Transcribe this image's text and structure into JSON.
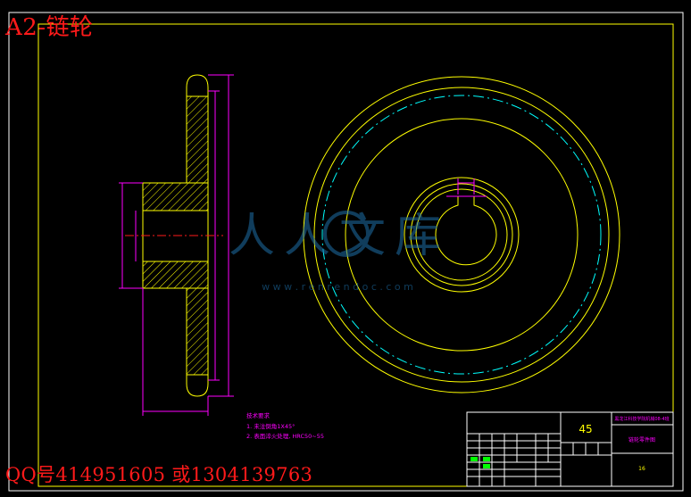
{
  "header": {
    "title": "A2-链轮"
  },
  "footer": {
    "contact": "QQ号414951605 或1304139763"
  },
  "notes": {
    "heading": "技术要求",
    "line1": "1. 未注倒角1X45°",
    "line2": "2. 表面淬火处理, HRC50~55"
  },
  "title_block": {
    "material": "45",
    "school": "黑龙江科技学院机械08-4班",
    "drawing_name": "链轮零件图",
    "sheet_code": "16"
  },
  "watermark": {
    "text": "人人文库",
    "url": "w w w . r e n r e n d o c . c o m"
  },
  "colors": {
    "background": "#000000",
    "outline": "#ffffff",
    "part": "#ffff00",
    "dimension": "#ff00ff",
    "centerline": "#00ffff",
    "annotation": "#ff1a1a",
    "title_block_green": "#00ff00"
  }
}
